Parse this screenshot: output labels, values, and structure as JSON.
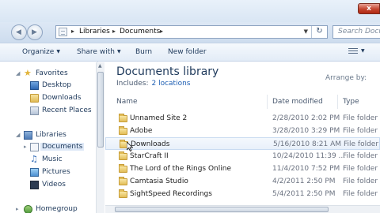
{
  "window": {
    "close_label": "x"
  },
  "address": {
    "crumbs": [
      "Libraries",
      "Documents"
    ],
    "search_placeholder": "Search Docum"
  },
  "toolbar": {
    "organize": "Organize",
    "share_with": "Share with",
    "burn": "Burn",
    "new_folder": "New folder"
  },
  "sidebar": {
    "favorites": "Favorites",
    "desktop": "Desktop",
    "downloads": "Downloads",
    "recent_places": "Recent Places",
    "libraries": "Libraries",
    "documents": "Documents",
    "music": "Music",
    "pictures": "Pictures",
    "videos": "Videos",
    "homegroup": "Homegroup"
  },
  "library": {
    "title": "Documents library",
    "includes_label": "Includes:",
    "includes_link": "2 locations",
    "arrange_by": "Arrange by:"
  },
  "columns": {
    "name": "Name",
    "date": "Date modified",
    "type": "Type"
  },
  "files": [
    {
      "name": "Unnamed Site 2",
      "date": "2/28/2010 2:02 PM",
      "type": "File folder"
    },
    {
      "name": "Adobe",
      "date": "3/28/2010 3:29 PM",
      "type": "File folder"
    },
    {
      "name": "Downloads",
      "date": "5/16/2010 8:21 AM",
      "type": "File folder"
    },
    {
      "name": "StarCraft II",
      "date": "10/24/2010 11:39 ...",
      "type": "File folder"
    },
    {
      "name": "The Lord of the Rings Online",
      "date": "11/4/2010 7:52 PM",
      "type": "File folder"
    },
    {
      "name": "Camtasia Studio",
      "date": "4/2/2011 2:50 PM",
      "type": "File folder"
    },
    {
      "name": "SightSpeed Recordings",
      "date": "5/4/2011 2:50 PM",
      "type": "File folder"
    }
  ]
}
